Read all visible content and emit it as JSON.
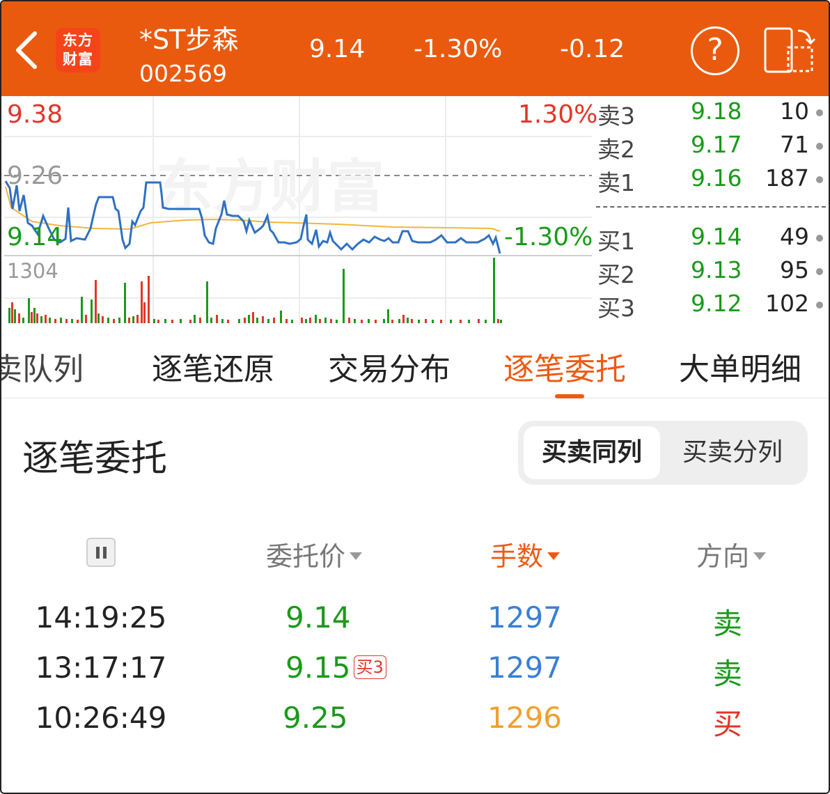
{
  "colors": {
    "header_bg": "#ea5a0e",
    "up": "#e0362a",
    "down": "#1a9a1a",
    "accent": "#ee5a12",
    "qty_blue": "#3b7fd4",
    "qty_orange": "#f0a030",
    "price_line": "#2f70c2",
    "avg_line": "#f2b53a"
  },
  "header": {
    "back_icon": "chevron-left-icon",
    "logo_line1": "东方",
    "logo_line2": "财富",
    "stock_name": "*ST步森",
    "stock_code": "002569",
    "price": "9.14",
    "change_pct": "-1.30%",
    "change": "-0.12",
    "help_icon": "question-circle-icon",
    "rotate_icon": "rotate-screen-icon"
  },
  "chart": {
    "watermark": "东方财富",
    "high_price": "9.38",
    "high_pct": "1.30%",
    "ref_price": "9.26",
    "low_price": "9.14",
    "low_pct": "-1.30%",
    "volume_max": "1304"
  },
  "book": {
    "asks": [
      {
        "label": "卖3",
        "price": "9.18",
        "vol": "10"
      },
      {
        "label": "卖2",
        "price": "9.17",
        "vol": "71"
      },
      {
        "label": "卖1",
        "price": "9.16",
        "vol": "187"
      }
    ],
    "bids": [
      {
        "label": "买1",
        "price": "9.14",
        "vol": "49"
      },
      {
        "label": "买2",
        "price": "9.13",
        "vol": "95"
      },
      {
        "label": "买3",
        "price": "9.12",
        "vol": "102"
      }
    ]
  },
  "tabs": [
    "卖队列",
    "逐笔还原",
    "交易分布",
    "逐笔委托",
    "大单明细"
  ],
  "active_tab": "逐笔委托",
  "section": {
    "title": "逐笔委托",
    "seg_on": "买卖同列",
    "seg_off": "买卖分列"
  },
  "table": {
    "pause_icon": "pause-icon",
    "col_price": "委托价",
    "col_qty": "手数",
    "col_dir": "方向",
    "rows": [
      {
        "time": "14:19:25",
        "price": "9.14",
        "tag": "",
        "qty": "1297",
        "dir": "卖"
      },
      {
        "time": "13:17:17",
        "price": "9.15",
        "tag": "买3",
        "qty": "1297",
        "dir": "卖"
      },
      {
        "time": "10:26:49",
        "price": "9.25",
        "tag": "",
        "qty": "1296",
        "dir": "买"
      }
    ]
  }
}
